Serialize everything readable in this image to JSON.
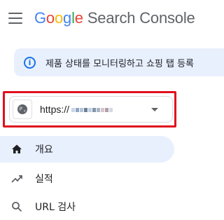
{
  "header": {
    "brand_letters": [
      {
        "char": "G",
        "color": "#4285f4"
      },
      {
        "char": "o",
        "color": "#ea4335"
      },
      {
        "char": "o",
        "color": "#fbbc05"
      },
      {
        "char": "g",
        "color": "#4285f4"
      },
      {
        "char": "l",
        "color": "#34a853"
      },
      {
        "char": "e",
        "color": "#ea4335"
      }
    ],
    "product_name": "Search Console",
    "menu_icon": "hamburger-menu-icon"
  },
  "notice": {
    "icon": "info-icon",
    "icon_glyph": "i",
    "text": "제품 상태를 모니터링하고 쇼핑 탭 등록"
  },
  "property": {
    "url_prefix": "https://",
    "icon": "globe-icon",
    "dropdown_icon": "caret-down-icon"
  },
  "nav": {
    "items": [
      {
        "label": "개요",
        "icon": "home-icon",
        "active": true
      },
      {
        "label": "실적",
        "icon": "trending-up-icon",
        "active": false
      },
      {
        "label": "URL 검사",
        "icon": "search-icon",
        "active": false
      }
    ]
  },
  "colors": {
    "accent_blue": "#1a73e8",
    "banner_bg": "#e8f0fe",
    "highlight_red": "#e0101e",
    "text_primary": "#202124",
    "text_secondary": "#5f6368"
  }
}
